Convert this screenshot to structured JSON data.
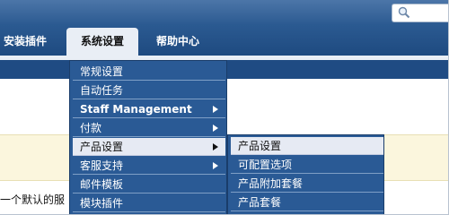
{
  "header": {
    "search_icon": "magnifier-icon",
    "tabs": [
      {
        "label": "安装插件",
        "active": false
      },
      {
        "label": "系统设置",
        "active": true
      },
      {
        "label": "帮助中心",
        "active": false
      }
    ]
  },
  "main_menu": {
    "items": [
      {
        "label": "常规设置",
        "has_submenu": false
      },
      {
        "label": "自动任务",
        "has_submenu": false
      },
      {
        "label": "Staff Management",
        "has_submenu": true
      },
      {
        "label": "付款",
        "has_submenu": true
      },
      {
        "label": "产品设置",
        "has_submenu": true,
        "highlighted": true
      },
      {
        "label": "客服支持",
        "has_submenu": true
      },
      {
        "label": "邮件模板",
        "has_submenu": false
      },
      {
        "label": "模块插件",
        "has_submenu": false
      }
    ]
  },
  "sub_menu": {
    "items": [
      {
        "label": "产品设置",
        "highlighted": true
      },
      {
        "label": "可配置选项"
      },
      {
        "label": "产品附加套餐"
      },
      {
        "label": "产品套餐"
      }
    ]
  },
  "content": {
    "partial_text": "一个默认的服"
  },
  "colors": {
    "header": "#2b5a91",
    "nav_bar": "#1f4b83",
    "menu_bg": "#2a5a95",
    "menu_hover": "#e6eaf3",
    "notice_bg": "#fbf6dd"
  }
}
